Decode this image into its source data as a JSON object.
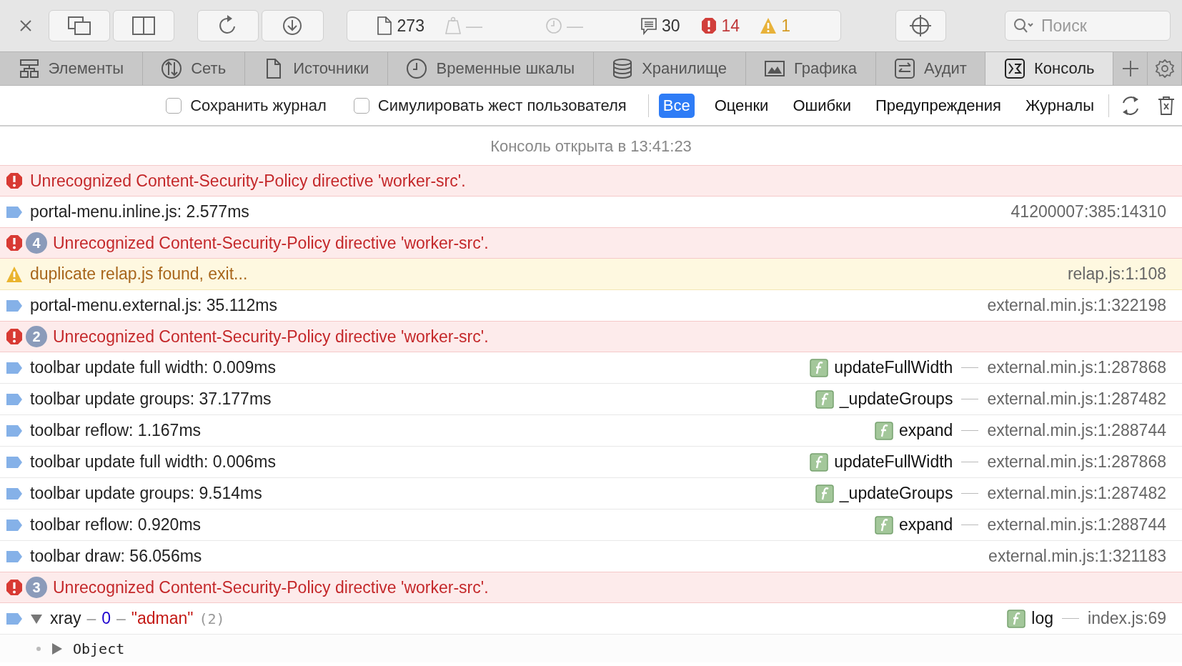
{
  "toolbar": {
    "buttons": [
      {
        "kind": "close"
      },
      {
        "kind": "windows"
      },
      {
        "kind": "split"
      },
      {
        "kind": "reload"
      },
      {
        "kind": "download"
      }
    ],
    "activity": [
      {
        "kind": "resources",
        "text": "273",
        "disabled": false
      },
      {
        "kind": "weight",
        "text": "—",
        "disabled": true
      },
      {
        "kind": "time",
        "text": "—",
        "disabled": true
      },
      {
        "kind": "logs",
        "text": "30",
        "disabled": false
      },
      {
        "kind": "errors",
        "text": "14",
        "disabled": false
      },
      {
        "kind": "warnings",
        "text": "1",
        "disabled": false
      }
    ],
    "search": {
      "placeholder": "Поиск"
    }
  },
  "tabs": [
    {
      "kind": "elements",
      "label": "Элементы",
      "selected": false
    },
    {
      "kind": "network",
      "label": "Сеть",
      "selected": false
    },
    {
      "kind": "sources",
      "label": "Источники",
      "selected": false
    },
    {
      "kind": "timelines",
      "label": "Временные шкалы",
      "selected": false
    },
    {
      "kind": "storage",
      "label": "Хранилище",
      "selected": false
    },
    {
      "kind": "graphics",
      "label": "Графика",
      "selected": false
    },
    {
      "kind": "audit",
      "label": "Аудит",
      "selected": false
    },
    {
      "kind": "console",
      "label": "Консоль",
      "selected": true
    }
  ],
  "filter_bar": {
    "checkboxes": [
      {
        "label": "Сохранить журнал",
        "checked": false
      },
      {
        "label": "Симулировать жест пользователя",
        "checked": false
      }
    ],
    "filters": [
      {
        "label": "Все",
        "selected": true
      },
      {
        "label": "Оценки",
        "selected": false
      },
      {
        "label": "Ошибки",
        "selected": false
      },
      {
        "label": "Предупреждения",
        "selected": false
      },
      {
        "label": "Журналы",
        "selected": false
      }
    ]
  },
  "console": {
    "opened": "Консоль открыта в 13:41:23",
    "rows": [
      {
        "kind": "error",
        "message": "Unrecognized Content-Security-Policy directive 'worker-src'."
      },
      {
        "kind": "log",
        "message": "portal-menu.inline.js: 2.577ms",
        "source": "41200007:385:14310"
      },
      {
        "kind": "error",
        "count": "4",
        "message": "Unrecognized Content-Security-Policy directive 'worker-src'."
      },
      {
        "kind": "warning",
        "message": "duplicate relap.js found, exit...",
        "source": "relap.js:1:108"
      },
      {
        "kind": "log",
        "message": "portal-menu.external.js: 35.112ms",
        "source": "external.min.js:1:322198"
      },
      {
        "kind": "error",
        "count": "2",
        "message": "Unrecognized Content-Security-Policy directive 'worker-src'."
      },
      {
        "kind": "log",
        "message": "toolbar update full width: 0.009ms",
        "function": "updateFullWidth",
        "source": "external.min.js:1:287868"
      },
      {
        "kind": "log",
        "message": "toolbar update groups: 37.177ms",
        "function": "_updateGroups",
        "source": "external.min.js:1:287482"
      },
      {
        "kind": "log",
        "message": "toolbar reflow: 1.167ms",
        "function": "expand",
        "source": "external.min.js:1:288744"
      },
      {
        "kind": "log",
        "message": "toolbar update full width: 0.006ms",
        "function": "updateFullWidth",
        "source": "external.min.js:1:287868"
      },
      {
        "kind": "log",
        "message": "toolbar update groups: 9.514ms",
        "function": "_updateGroups",
        "source": "external.min.js:1:287482"
      },
      {
        "kind": "log",
        "message": "toolbar reflow: 0.920ms",
        "function": "expand",
        "source": "external.min.js:1:288744"
      },
      {
        "kind": "log",
        "message": "toolbar draw: 56.056ms",
        "source": "external.min.js:1:321183"
      },
      {
        "kind": "error",
        "count": "3",
        "message": "Unrecognized Content-Security-Policy directive 'worker-src'."
      },
      {
        "kind": "object",
        "expanded": true,
        "parts": [
          {
            "kind": "name",
            "text": "xray"
          },
          {
            "kind": "sep",
            "text": "–"
          },
          {
            "kind": "number",
            "text": "0"
          },
          {
            "kind": "sep",
            "text": "–"
          },
          {
            "kind": "string",
            "text": "\"adman\""
          },
          {
            "kind": "count",
            "text": "(2)"
          }
        ],
        "function": "log",
        "source": "index.js:69",
        "children": [
          {
            "text": "Object",
            "expanded": false
          }
        ]
      }
    ]
  }
}
